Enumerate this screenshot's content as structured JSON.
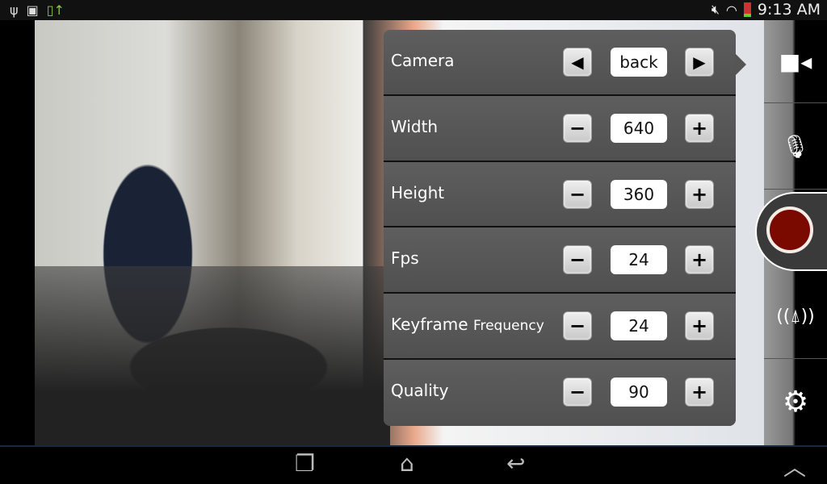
{
  "status_bar": {
    "left_icons": [
      "usb-icon",
      "gallery-icon",
      "app-update-icon"
    ],
    "right_icons": [
      "mute-icon",
      "wifi-icon",
      "battery-icon"
    ],
    "time": "9:13 AM"
  },
  "settings": [
    {
      "label": "Camera",
      "dec": "◀",
      "value": "back",
      "inc": "▶"
    },
    {
      "label": "Width",
      "dec": "−",
      "value": "640",
      "inc": "+"
    },
    {
      "label": "Height",
      "dec": "−",
      "value": "360",
      "inc": "+"
    },
    {
      "label": "Fps",
      "dec": "−",
      "value": "24",
      "inc": "+"
    },
    {
      "label": "Keyframe",
      "label_small": "Frequency",
      "dec": "−",
      "value": "24",
      "inc": "+"
    },
    {
      "label": "Quality",
      "dec": "−",
      "value": "90",
      "inc": "+"
    }
  ],
  "sidebar": [
    "video-camera-icon",
    "microphone-icon",
    "record-button",
    "broadcast-icon",
    "settings-gear-icon"
  ],
  "record_color": "#7a0a00",
  "nav": [
    "recent-apps-icon",
    "home-icon",
    "back-icon",
    "up-chevron-icon"
  ]
}
